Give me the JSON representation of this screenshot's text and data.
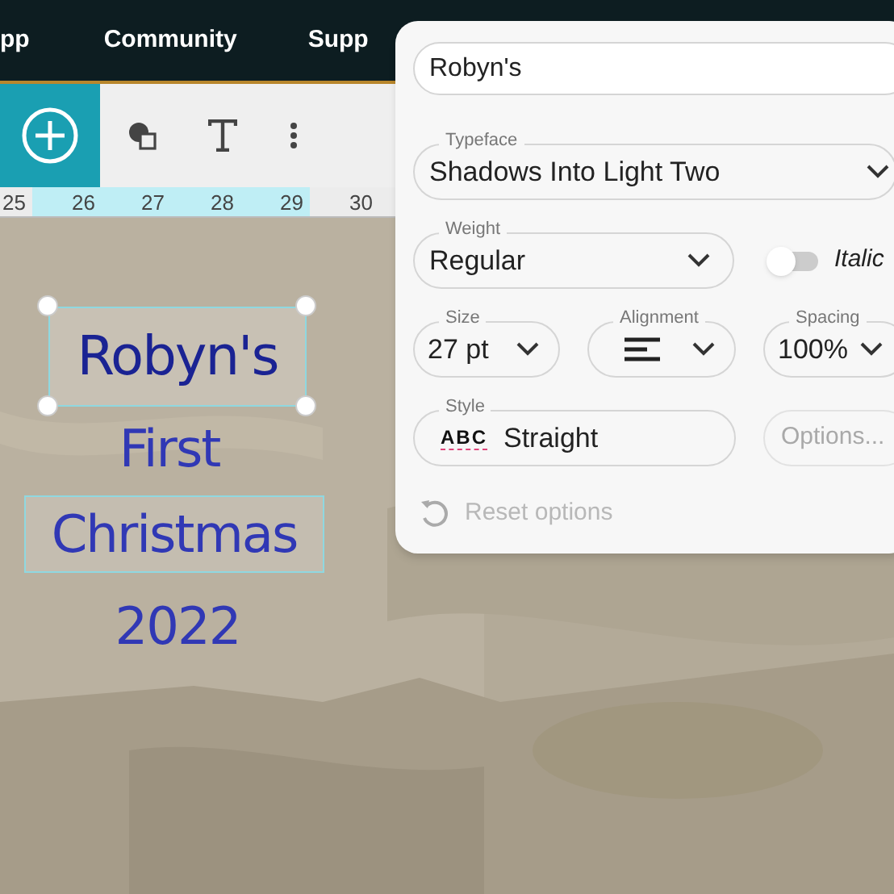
{
  "nav": {
    "items": [
      "pp",
      "Community",
      "Supp"
    ]
  },
  "ruler": {
    "labels": [
      {
        "text": "25",
        "highlighted": false
      },
      {
        "text": "26",
        "highlighted": true
      },
      {
        "text": "27",
        "highlighted": true
      },
      {
        "text": "28",
        "highlighted": true
      },
      {
        "text": "29",
        "highlighted": true
      },
      {
        "text": "30",
        "highlighted": false
      }
    ]
  },
  "canvas": {
    "texts": [
      {
        "text": "Robyn's",
        "selected": true,
        "outlined": false
      },
      {
        "text": "First",
        "selected": false,
        "outlined": false
      },
      {
        "text": "Christmas",
        "selected": false,
        "outlined": true
      },
      {
        "text": "2022",
        "selected": false,
        "outlined": false
      }
    ]
  },
  "panel": {
    "text_value": "Robyn's",
    "typeface": {
      "label": "Typeface",
      "value": "Shadows Into Light Two"
    },
    "weight": {
      "label": "Weight",
      "value": "Regular"
    },
    "italic": {
      "label": "Italic",
      "on": false
    },
    "size": {
      "label": "Size",
      "value": "27 pt"
    },
    "alignment": {
      "label": "Alignment"
    },
    "spacing": {
      "label": "Spacing",
      "value": "100%"
    },
    "style": {
      "label": "Style",
      "icon_text": "ABC",
      "value": "Straight"
    },
    "options": {
      "label": "Options...",
      "disabled": true
    },
    "reset": {
      "label": "Reset options",
      "disabled": true
    }
  }
}
